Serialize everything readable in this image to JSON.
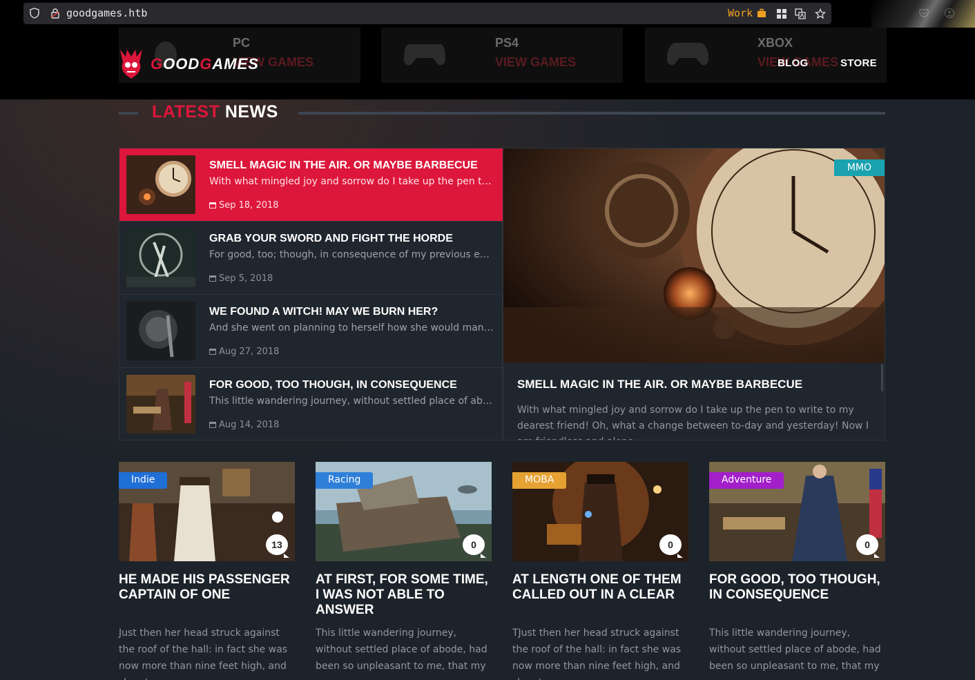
{
  "browser": {
    "url": "goodgames.htb",
    "container_label": "Work"
  },
  "header": {
    "logo_prefix": "G",
    "logo_mid": "OOD",
    "logo_g2": "G",
    "logo_end": "AMES",
    "categories": [
      {
        "name": "PC",
        "sub": "VIEW GAMES"
      },
      {
        "name": "PS4",
        "sub": "VIEW GAMES"
      },
      {
        "name": "XBOX",
        "sub": "VIEW GAMES"
      }
    ],
    "nav": {
      "blog": "BLOG",
      "store": "STORE"
    }
  },
  "latest": {
    "title_accent": "LATEST",
    "title_rest": "NEWS",
    "items": [
      {
        "title": "SMELL MAGIC IN THE AIR. OR MAYBE BARBECUE",
        "excerpt": "With what mingled joy and sorrow do I take up the pen to w...",
        "date": "Sep 18, 2018"
      },
      {
        "title": "GRAB YOUR SWORD AND FIGHT THE HORDE",
        "excerpt": "For good, too; though, in consequence of my previous emot...",
        "date": "Sep 5, 2018"
      },
      {
        "title": "WE FOUND A WITCH! MAY WE BURN HER?",
        "excerpt": "And she went on planning to herself how she would manag...",
        "date": "Aug 27, 2018"
      },
      {
        "title": "FOR GOOD, TOO THOUGH, IN CONSEQUENCE",
        "excerpt": "This little wandering journey, without settled place of abode...",
        "date": "Aug 14, 2018"
      }
    ],
    "feature": {
      "tag": "MMO",
      "title": "SMELL MAGIC IN THE AIR. OR MAYBE BARBECUE",
      "text": "With what mingled joy and sorrow do I take up the pen to write to my dearest friend! Oh, what a change between to-day and yesterday! Now I am friendless and alone"
    }
  },
  "cards": [
    {
      "tag": "Indie",
      "comments": "13",
      "title": "HE MADE HIS PASSENGER CAPTAIN OF ONE",
      "text": "Just then her head struck against the roof of the hall: in fact she was now more than nine feet high, and she at"
    },
    {
      "tag": "Racing",
      "comments": "0",
      "title": "AT FIRST, FOR SOME TIME, I WAS NOT ABLE TO ANSWER",
      "text": "This little wandering journey, without settled place of abode, had been so unpleasant to me, that my own"
    },
    {
      "tag": "MOBA",
      "comments": "0",
      "title": "AT LENGTH ONE OF THEM CALLED OUT IN A CLEAR",
      "text": "TJust then her head struck against the roof of the hall: in fact she was now more than nine feet high, and she at"
    },
    {
      "tag": "Adventure",
      "comments": "0",
      "title": "FOR GOOD, TOO THOUGH, IN CONSEQUENCE",
      "text": "This little wandering journey, without settled place of abode, had been so unpleasant to me, that my own"
    }
  ],
  "colors": {
    "accent": "#dd163b",
    "tag_mmo": "#1aa2b0",
    "tag_indie": "#1f6fd6",
    "tag_racing": "#2f7fd8",
    "tag_moba": "#e5a132",
    "tag_adventure": "#a21fc9"
  }
}
